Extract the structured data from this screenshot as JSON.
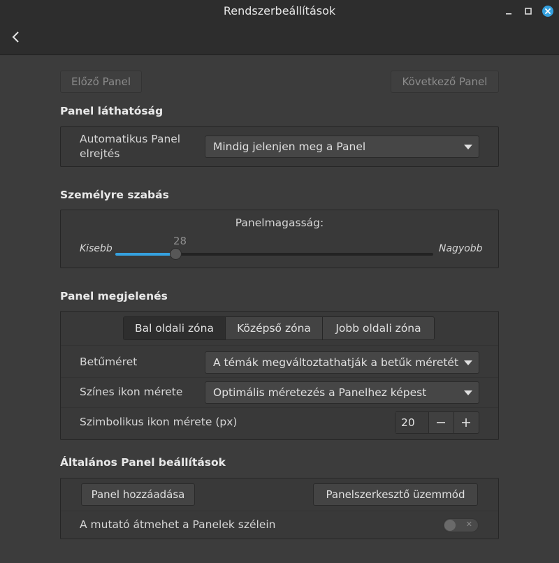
{
  "window": {
    "title": "Rendszerbeállítások",
    "controls": [
      "minimize-icon",
      "maximize-icon",
      "close-icon"
    ],
    "back_icon": "chevron-left-icon"
  },
  "nav": {
    "prev_panel": "Előző Panel",
    "next_panel": "Következő Panel"
  },
  "visibility": {
    "heading": "Panel láthatóság",
    "autohide_label_line1": "Automatikus Panel",
    "autohide_label_line2": "elrejtés",
    "autohide_value": "Mindig jelenjen meg a Panel"
  },
  "customize": {
    "heading": "Személyre szabás",
    "height_label": "Panelmagasság:",
    "min_label": "Kisebb",
    "max_label": "Nagyobb",
    "height_value": "28",
    "height_fraction": 0.19
  },
  "appearance": {
    "heading": "Panel megjelenés",
    "tabs": [
      {
        "label": "Bal oldali zóna",
        "active": true
      },
      {
        "label": "Középső zóna",
        "active": false
      },
      {
        "label": "Jobb oldali zóna",
        "active": false
      }
    ],
    "font_size_label": "Betűméret",
    "font_size_value": "A témák megváltoztathatják a betűk méretét",
    "color_icon_label": "Színes ikon mérete",
    "color_icon_value": "Optimális méretezés a Panelhez képest",
    "symbolic_icon_label": "Szimbolikus ikon mérete (px)",
    "symbolic_icon_value": "20"
  },
  "general": {
    "heading": "Általános Panel beállítások",
    "add_panel": "Panel hozzáadása",
    "edit_mode": "Panelszerkesztő üzemmód",
    "pointer_label": "A mutató átmehet a Panelek szélein",
    "pointer_enabled": false
  },
  "colors": {
    "accent": "#35a1df",
    "window_bg": "#3c3c3c",
    "header_bg": "#2d2d2d"
  }
}
